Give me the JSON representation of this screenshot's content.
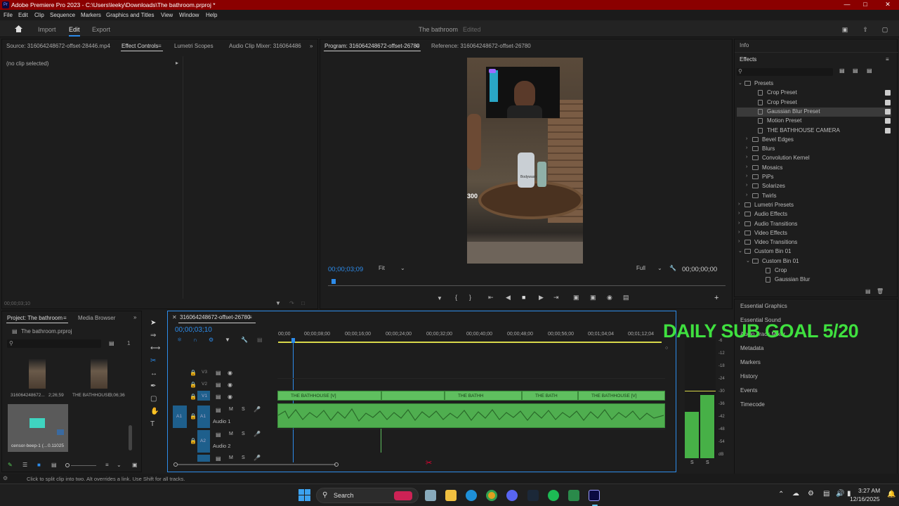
{
  "window": {
    "title": "Adobe Premiere Pro 2023 - C:\\Users\\leeky\\Downloads\\The bathroom.prproj *",
    "app_icon": "Pr"
  },
  "menu": [
    "File",
    "Edit",
    "Clip",
    "Sequence",
    "Markers",
    "Graphics and Titles",
    "View",
    "Window",
    "Help"
  ],
  "workspace": {
    "tabs": [
      "Import",
      "Edit",
      "Export"
    ],
    "active_tab": "Edit",
    "project_title": "The bathroom",
    "project_status": "Edited"
  },
  "source_panel": {
    "tabs": [
      "Source: 316064248672-offset-28446.mp4",
      "Effect Controls",
      "Lumetri Scopes",
      "Audio Clip Mixer: 316064486"
    ],
    "no_clip": "(no clip selected)",
    "timecode": "00;00;03;10"
  },
  "program_panel": {
    "tabs": [
      "Program: 316064248672-offset-26780",
      "Reference: 316064248672-offset-26780"
    ],
    "timecode": "00;00;03;09",
    "fit": "Fit",
    "quality": "Full",
    "duration": "00;00;00;00",
    "frame_text": "300",
    "bottle_label": "Bodywash"
  },
  "right_panel": {
    "info": "Info",
    "effects_title": "Effects",
    "effects_tree": [
      {
        "label": "Presets",
        "level": 0,
        "expanded": true,
        "folder": true
      },
      {
        "label": "Crop Preset",
        "level": 1,
        "badge": true
      },
      {
        "label": "Crop Preset",
        "level": 1,
        "badge": true
      },
      {
        "label": "Gaussian Blur Preset",
        "level": 1,
        "badge": true,
        "selected": true
      },
      {
        "label": "Motion Preset",
        "level": 1,
        "badge": true
      },
      {
        "label": "THE BATHHOUSE CAMERA",
        "level": 1,
        "badge": true
      },
      {
        "label": "Bevel Edges",
        "level": 1,
        "folder": true
      },
      {
        "label": "Blurs",
        "level": 1,
        "folder": true
      },
      {
        "label": "Convolution Kernel",
        "level": 1,
        "folder": true
      },
      {
        "label": "Mosaics",
        "level": 1,
        "folder": true
      },
      {
        "label": "PiPs",
        "level": 1,
        "folder": true
      },
      {
        "label": "Solarizes",
        "level": 1,
        "folder": true
      },
      {
        "label": "Twirls",
        "level": 1,
        "folder": true
      },
      {
        "label": "Lumetri Presets",
        "level": 0,
        "folder": true
      },
      {
        "label": "Audio Effects",
        "level": 0,
        "folder": true
      },
      {
        "label": "Audio Transitions",
        "level": 0,
        "folder": true
      },
      {
        "label": "Video Effects",
        "level": 0,
        "folder": true
      },
      {
        "label": "Video Transitions",
        "level": 0,
        "folder": true
      },
      {
        "label": "Custom Bin 01",
        "level": 0,
        "expanded": true,
        "folder": true
      },
      {
        "label": "Custom Bin 01",
        "level": 1,
        "expanded": true,
        "folder": true
      },
      {
        "label": "Crop",
        "level": 2
      },
      {
        "label": "Gaussian Blur",
        "level": 2
      }
    ],
    "lower_panels": [
      "Essential Graphics",
      "Essential Sound",
      "Audio Track Mixer",
      "Metadata",
      "Markers",
      "History",
      "Events",
      "Timecode"
    ]
  },
  "overlay_text": "DAILY SUB GOAL 5/20",
  "project_panel": {
    "tabs": [
      "Project: The bathroom",
      "Media Browser"
    ],
    "file": "The bathroom.prproj",
    "count": "1",
    "items": [
      {
        "name": "316064248672...",
        "duration": "2;26;59"
      },
      {
        "name": "THE BATHHOUSE",
        "duration": "3;06;36"
      },
      {
        "name": "censor-beep-1 (...",
        "duration": "0.11025"
      }
    ]
  },
  "timeline": {
    "sequence_name": "316064248672-offset-26780",
    "timecode": "00;00;03;10",
    "ruler": [
      "00;00",
      "00;00;08;00",
      "00;00;16;00",
      "00;00;24;00",
      "00;00;32;00",
      "00;00;40;00",
      "00;00;48;00",
      "00;00;56;00",
      "00;01;04;04",
      "00;01;12;04"
    ],
    "tracks": {
      "video": [
        "V3",
        "V2",
        "V1"
      ],
      "audio": [
        {
          "id": "A1",
          "name": "Audio 1"
        },
        {
          "id": "A2",
          "name": "Audio 2"
        }
      ]
    },
    "clips": [
      {
        "label": "THE BATHHOUSE [V]"
      },
      {
        "label": "THE BATHH"
      },
      {
        "label": "THE BATH"
      },
      {
        "label": "THE BATHHOUSE [V]"
      }
    ],
    "src_a1": "A1",
    "meter_scale": [
      "-6",
      "-12",
      "-18",
      "-24",
      "-30",
      "-36",
      "-42",
      "-48",
      "-54",
      "dB"
    ],
    "meter_solo": [
      "S",
      "S"
    ]
  },
  "status_bar": "Click to split clip into two. Alt overrides a link. Use Shift for all tracks.",
  "taskbar": {
    "search": "Search",
    "time": "3:27 AM",
    "date": "12/16/2025"
  },
  "colors": {
    "title_bar": "#8b0000",
    "accent": "#2d8ceb",
    "clip_green": "#5fbf5f",
    "overlay_green": "#3fe03f"
  }
}
